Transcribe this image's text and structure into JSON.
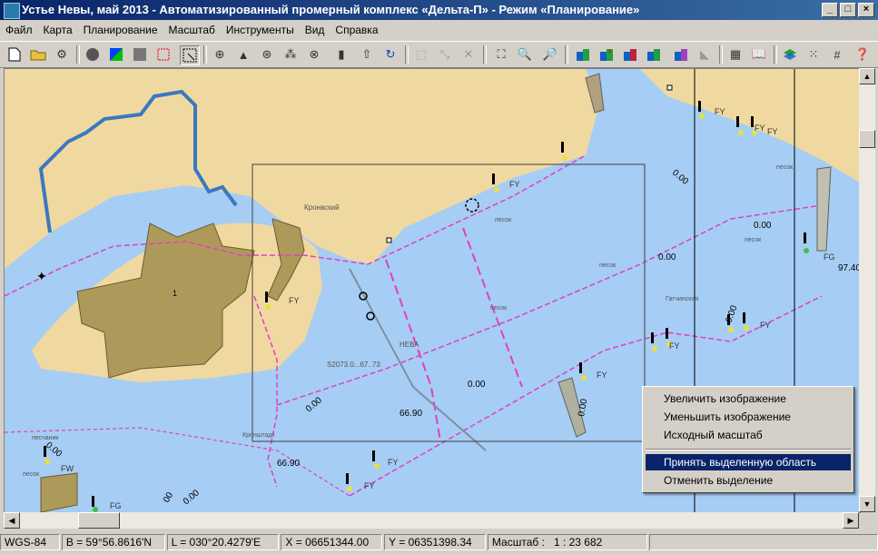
{
  "window": {
    "title": "Устье Невы, май 2013 - Автоматизированный промерный комплекс «Дельта-П» - Режим «Планирование»",
    "minimize": "_",
    "maximize": "□",
    "close": "×"
  },
  "menu": [
    "Файл",
    "Карта",
    "Планирование",
    "Масштаб",
    "Инструменты",
    "Вид",
    "Справка"
  ],
  "toolbar_icons": [
    "new-file-icon",
    "open-folder-icon",
    "gear-icon",
    "circle-icon",
    "polygon-icon",
    "square-icon",
    "red-square-icon",
    "select-area-icon",
    "crosshair-icon",
    "cone-icon",
    "globe-icon",
    "point-cluster-icon",
    "grid-circle-icon",
    "ruler-icon",
    "arrow-up-icon",
    "rotate-icon",
    "select-icon",
    "zoom-extents-icon",
    "lasso-icon",
    "fit-window-icon",
    "zoom-in-icon",
    "zoom-out-icon",
    "track-icon-1",
    "track-icon-2",
    "track-icon-3",
    "track-icon-4",
    "track-icon-5",
    "calculator-icon",
    "book-icon",
    "layers-icon",
    "points-icon",
    "grid-icon",
    "help-icon"
  ],
  "map": {
    "labels": [
      "Кронвский",
      "песок",
      "песок",
      "песок",
      "НЕВА",
      "Кронштадт",
      "песчаник",
      "песок",
      "песок",
      "песок",
      "Гатчинская"
    ],
    "depth_labels": [
      "0.00",
      "0.00",
      "0.00",
      "0.00",
      "0.00",
      "0.00",
      "0.00",
      "0.00",
      "0.00",
      "66.90",
      "66.90",
      "97.40",
      "00"
    ],
    "buoy_labels": [
      "FY",
      "FY",
      "FY",
      "FY",
      "FY",
      "FY",
      "FY",
      "FY",
      "FY",
      "FY",
      "FW",
      "FG",
      "FG",
      "FY"
    ],
    "sounding_text": "S2073.0...67..73",
    "island_marker": "1",
    "colors": {
      "water": "#a6cdf4",
      "land": "#f0d9a0",
      "fort": "#ad9a5a",
      "boundary": "#e040c0",
      "canal": "#3a78c0"
    }
  },
  "context_menu": {
    "items": [
      "Увеличить изображение",
      "Уменьшить изображение",
      "Исходный масштаб",
      "Принять выделенную область",
      "Отменить выделение"
    ],
    "selected": "Принять выделенную область"
  },
  "status": {
    "datum": "WGS-84",
    "lat": "B = 59°56.8616'N",
    "lon": "L = 030°20.4279'E",
    "x": "X = 06651344.00",
    "y": "Y = 06351398.34",
    "scale_label": "Масштаб :",
    "scale_value": "1 : 23 682"
  }
}
